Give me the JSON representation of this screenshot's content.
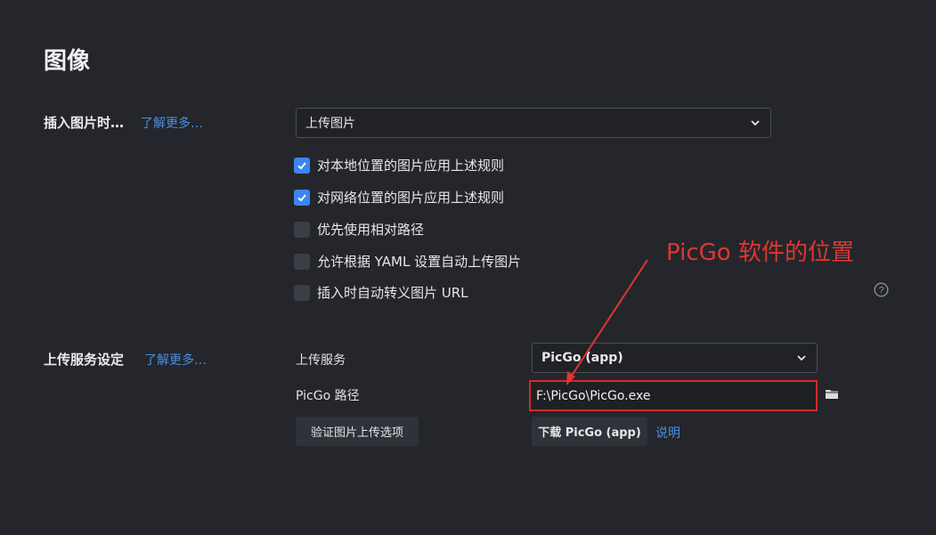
{
  "page": {
    "title": "图像"
  },
  "insert_section": {
    "label": "插入图片时…",
    "learn_more": "了解更多…",
    "select_value": "上传图片",
    "checkboxes": [
      {
        "label": "对本地位置的图片应用上述规则",
        "checked": true
      },
      {
        "label": "对网络位置的图片应用上述规则",
        "checked": true
      },
      {
        "label": "优先使用相对路径",
        "checked": false
      },
      {
        "label": "允许根据 YAML 设置自动上传图片",
        "checked": false
      },
      {
        "label": "插入时自动转义图片 URL",
        "checked": false
      }
    ],
    "help_icon": "?"
  },
  "upload_section": {
    "label": "上传服务设定",
    "learn_more": "了解更多…",
    "service_label": "上传服务",
    "service_value": "PicGo (app)",
    "path_label": "PicGo 路径",
    "path_value": "F:\\PicGo\\PicGo.exe",
    "verify_button": "验证图片上传选项",
    "download_button": "下载 PicGo (app)",
    "explain_link": "说明"
  },
  "annotation": {
    "text": "PicGo 软件的位置"
  },
  "colors": {
    "background": "#24262c",
    "accent": "#3c86f2",
    "link": "#4a8fe0",
    "annotation": "#e0362e"
  },
  "icons": {
    "folder": "folder-icon",
    "chevron": "chevron-down-icon",
    "check": "check-icon",
    "help": "help-icon"
  }
}
